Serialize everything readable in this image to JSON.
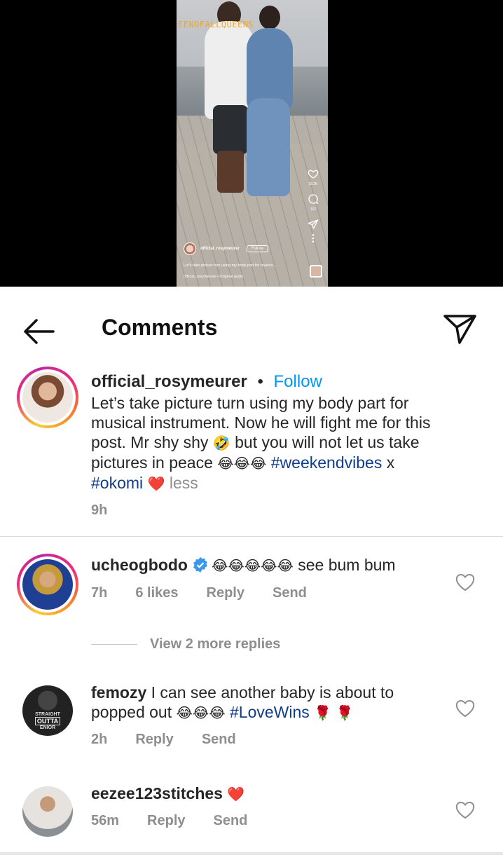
{
  "video": {
    "watermark": "EENOFALLQUEENS",
    "like_count": "39.2K",
    "comment_count": "102",
    "username": "official_rosymeurer",
    "follow_label": "Follow",
    "caption": "Let's take picture turn using my body part for musica...",
    "audio": "official_rosymeurer • Original audio"
  },
  "header": {
    "title": "Comments"
  },
  "post": {
    "username": "official_rosymeurer",
    "separator": "•",
    "follow": "Follow",
    "caption_line1": "Let’s take picture turn using my body part for",
    "caption_line2": "musical instrument. Now he will fight me for this",
    "caption_line3a": "post. Mr shy shy ",
    "caption_line3_emoji": "🤣",
    "caption_line3b": " but you will not let us take",
    "caption_line4a": "pictures in peace ",
    "caption_line4_emoji": "😂😂😂",
    "hashtag1": "#weekendvibes",
    "caption_line4b": " x",
    "hashtag2": "#okomi",
    "heart_emoji": "❤️",
    "less": "less",
    "time": "9h"
  },
  "comments": [
    {
      "username": "ucheogbodo",
      "verified": true,
      "emoji": "😂😂😂😂😂",
      "text": " see bum bum",
      "time": "7h",
      "likes": "6 likes",
      "reply": "Reply",
      "send": "Send"
    },
    {
      "username": "femozy",
      "text_line1": " I can see another baby is about to",
      "text_line2a": "popped out ",
      "emoji": "😂😂😂",
      "hashtag": "#LoveWins",
      "roses": "🌹 🌹",
      "avatar_text_1": "STRAIGHT",
      "avatar_text_2": "OUTTA",
      "avatar_text_3": "ENIOR",
      "time": "2h",
      "reply": "Reply",
      "send": "Send"
    },
    {
      "username": "eezee123stitches",
      "emoji": "❤️",
      "time": "56m",
      "reply": "Reply",
      "send": "Send"
    }
  ],
  "view_replies": "View 2 more replies",
  "colors": {
    "follow_blue": "#0095f6",
    "hashtag_blue": "#0f3d8c",
    "muted_gray": "#8e8e8e",
    "heart_red": "#e0245e"
  }
}
